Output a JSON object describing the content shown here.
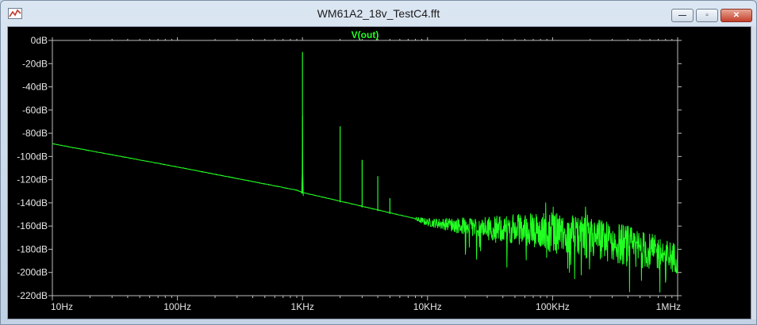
{
  "window": {
    "title": "WM61A2_18v_TestC4.fft",
    "minimize_symbol": "—",
    "maximize_symbol": "▫",
    "close_symbol": "✕",
    "app_icon": "waveform-icon"
  },
  "colors": {
    "trace": "#22ff22",
    "background": "#000000",
    "axis": "#bdbdbd",
    "label": "#e6e6e6"
  },
  "chart_data": {
    "type": "line",
    "trace_name": "V(out)",
    "x_scale": "log",
    "x_unit": "Hz",
    "xlim": [
      10,
      1000000
    ],
    "ylim": [
      -220,
      0
    ],
    "x_tick_labels": [
      "10Hz",
      "100Hz",
      "1KHz",
      "10KHz",
      "100KHz",
      "1MHz"
    ],
    "x_tick_values": [
      10,
      100,
      1000,
      10000,
      100000,
      1000000
    ],
    "y_tick_labels": [
      "0dB",
      "-20dB",
      "-40dB",
      "-60dB",
      "-80dB",
      "-100dB",
      "-120dB",
      "-140dB",
      "-160dB",
      "-180dB",
      "-200dB",
      "-220dB"
    ],
    "y_tick_values": [
      0,
      -20,
      -40,
      -60,
      -80,
      -100,
      -120,
      -140,
      -160,
      -180,
      -200,
      -220
    ],
    "grid": false,
    "series": [
      {
        "name": "V(out)",
        "noise_floor": {
          "x": [
            10,
            100,
            900,
            1000,
            1100,
            10000,
            30000,
            60000,
            100000,
            300000,
            1000000
          ],
          "y": [
            -89,
            -109,
            -129,
            -131,
            -132,
            -156,
            -160,
            -160,
            -162,
            -170,
            -185
          ]
        },
        "peaks": {
          "x": [
            1000,
            2000,
            3000,
            4000,
            5000
          ],
          "y": [
            -10,
            -74,
            -103,
            -117,
            -136
          ]
        }
      }
    ]
  }
}
